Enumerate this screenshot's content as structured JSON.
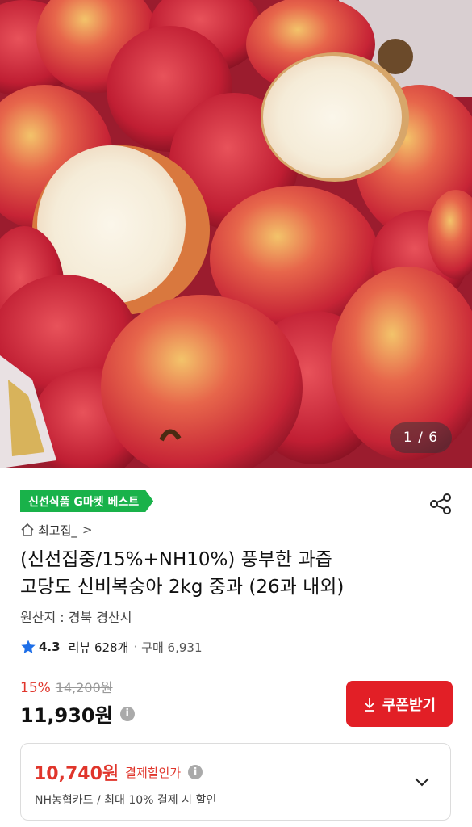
{
  "gallery": {
    "counter": "1 / 6",
    "image_alt": "peaches"
  },
  "badge": {
    "label": "신선식품 G마켓 베스트"
  },
  "icons": {
    "share": "share-icon",
    "home": "home-icon",
    "star": "star-icon",
    "info": "info-icon",
    "download": "download-icon",
    "chevron": "chevron-down-icon"
  },
  "store": {
    "name": "최고집_",
    "chevron": ">"
  },
  "product": {
    "title_line1": "(신선집중/15%+NH10%) 풍부한 과즙",
    "title_line2": "고당도 신비복숭아 2kg 중과 (26과 내외)",
    "origin": "원산지 : 경북 경산시"
  },
  "rating": {
    "score": "4.3",
    "reviews": "리뷰 628개",
    "dot": "·",
    "purchases": "구매 6,931"
  },
  "price": {
    "discount_pct": "15%",
    "original": "14,200원",
    "final": "11,930원",
    "info_glyph": "i"
  },
  "coupon": {
    "label": "쿠폰받기"
  },
  "payment": {
    "amount": "10,740원",
    "label": "결제할인가",
    "note": "NH농협카드 / 최대 10% 결제 시 할인"
  },
  "colors": {
    "accent": "#e21f26",
    "badge": "#19b24a",
    "star": "#1e6fe8"
  }
}
